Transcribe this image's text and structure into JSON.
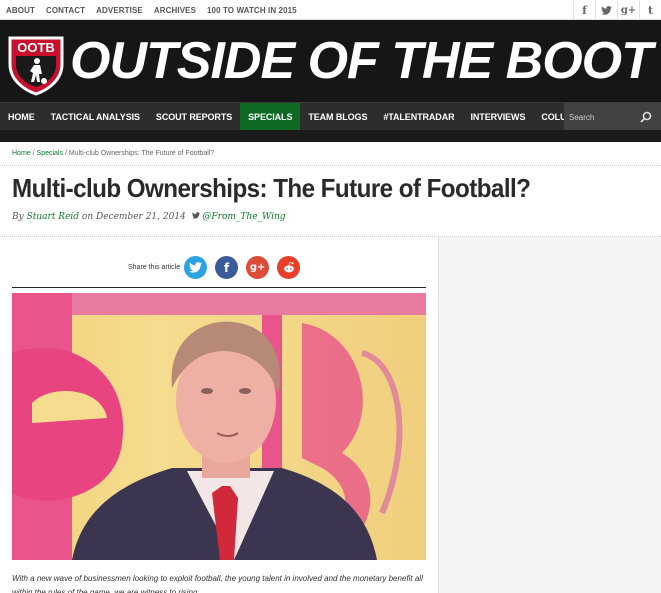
{
  "topnav": {
    "links": [
      "ABOUT",
      "CONTACT",
      "ADVERTISE",
      "ARCHIVES",
      "100 TO WATCH IN 2015"
    ]
  },
  "social_top": [
    {
      "icon": "facebook-icon",
      "glyph": "f"
    },
    {
      "icon": "twitter-icon",
      "glyph": "t"
    },
    {
      "icon": "googleplus-icon",
      "glyph": "g+"
    },
    {
      "icon": "tumblr-icon",
      "glyph": "t"
    }
  ],
  "header": {
    "logo_text": "OOTB",
    "site_title": "OUTSIDE OF THE BOOT"
  },
  "nav": {
    "items": [
      "HOME",
      "TACTICAL ANALYSIS",
      "SCOUT REPORTS",
      "SPECIALS",
      "TEAM BLOGS",
      "#TALENTRADAR",
      "INTERVIEWS",
      "COLUMNS"
    ],
    "active": "SPECIALS",
    "search_placeholder": "Search"
  },
  "breadcrumb": {
    "home": "Home",
    "section": "Specials",
    "current": "Multi-club Ownerships: The Future of Football?"
  },
  "article": {
    "title": "Multi-club Ownerships: The Future of Football?",
    "by": "By",
    "author": "Stuart Reid",
    "on": "on December 21, 2014",
    "twitter_handle": "@From_The_Wing",
    "share_label": "Share this article",
    "intro": "With a new wave of businessmen looking to exploit football, the young talent in involved and the monetary benefit all within the rules of the game, we are witness to rising"
  },
  "colors": {
    "accent_green": "#0c6a23",
    "header_bg": "#161616",
    "nav_bg": "#2d2d2d"
  }
}
